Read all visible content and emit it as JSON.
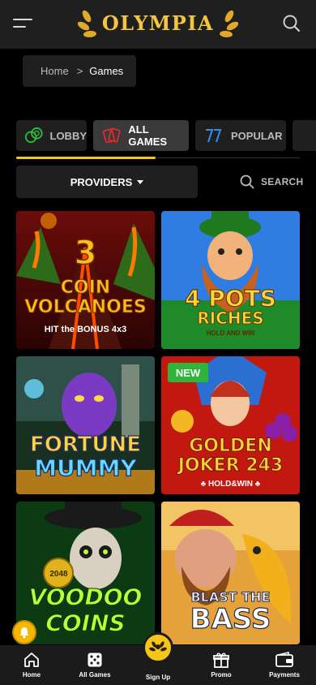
{
  "header": {
    "logo_text": "OLYMPIA",
    "menu_icon": "hamburger-icon",
    "search_icon": "search-icon"
  },
  "breadcrumb": {
    "home": "Home",
    "separator": ">",
    "current": "Games"
  },
  "tabs": [
    {
      "label": "LOBBY",
      "icon": "chips-icon",
      "active": false
    },
    {
      "label": "ALL GAMES",
      "icon": "cards-icon",
      "active": true
    },
    {
      "label": "POPULAR",
      "icon": "sevens-icon",
      "active": false
    }
  ],
  "filters": {
    "providers_label": "PROVIDERS",
    "search_label": "SEARCH"
  },
  "games": [
    {
      "title_line1": "3",
      "title_line2": "COIN",
      "title_line3": "VOLCANOES",
      "subtitle": "HIT the BONUS 4x3",
      "badge": ""
    },
    {
      "title_line1": "4 POTS",
      "title_line2": "RICHES",
      "subtitle": "HOLD AND WIN",
      "badge": ""
    },
    {
      "title_line1": "FORTUNE",
      "title_line2": "MUMMY",
      "badge": ""
    },
    {
      "title_line1": "GOLDEN",
      "title_line2": "JOKER 243",
      "subtitle": "♣ HOLD&WIN ♣",
      "badge": "NEW"
    },
    {
      "title_line1": "VOODOO",
      "title_line2": "COINS",
      "coin_value": "2048",
      "badge": ""
    },
    {
      "title_line1": "BLAST THE",
      "title_line2": "BASS",
      "badge": ""
    }
  ],
  "bottom_nav": [
    {
      "label": "Home",
      "icon": "home-icon"
    },
    {
      "label": "All Games",
      "icon": "dice-icon"
    },
    {
      "label": "Sign Up",
      "icon": "laurel-icon"
    },
    {
      "label": "Promo",
      "icon": "gift-icon"
    },
    {
      "label": "Payments",
      "icon": "wallet-icon"
    }
  ],
  "colors": {
    "accent": "#f5c518",
    "background": "#000000",
    "surface": "#1f1f1f",
    "new_badge": "#2fb53a"
  }
}
